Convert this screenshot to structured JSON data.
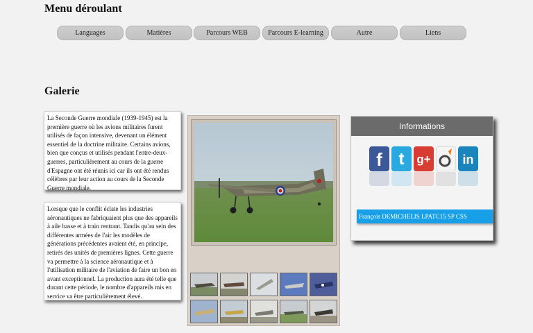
{
  "headings": {
    "menu_title": "Menu déroulant",
    "gallery_title": "Galerie"
  },
  "menu": {
    "items": [
      {
        "label": "Languages"
      },
      {
        "label": "Matières"
      },
      {
        "label": "Parcours WEB"
      },
      {
        "label": "Parcours E-learning"
      },
      {
        "label": "Autre"
      },
      {
        "label": "Liens"
      }
    ]
  },
  "articles": [
    {
      "text": "La Seconde Guerre mondiale (1939-1945) est la première guerre où les avions militaires furent utilisés de façon intensive, devenant un élément essentiel de la doctrine militaire. Certains avions, bien que conçus et utilisés pendant l'entre-deux-guerres, particulièrement au cours de la guerre d'Espagne ont été réunis ici car ils ont été rendus célèbres par leur action au cours de la Seconde Guerre mondiale."
    },
    {
      "text": "Lorsque que le conflit éclate les industries aéronautiques ne fabriquaient plus que des appareils à aile basse et à train rentrant. Tandis qu'au sein des différentes armées de l'air les modèles de générations précédentes avaient été, en principe, retirés des unités de premières lignes. Cette guerre va permettre à la science aéronautique et à l'utilisation militaire de l'aviation de faire un bon en avant exceptionnel. La production aura été telle que durant cette période, le nombre d'appareils mis en service va être particulièrement élevé."
    }
  ],
  "gallery": {
    "main_photo": "spitfire-photo",
    "thumbnails": [
      {
        "name": "thumb-plane-1"
      },
      {
        "name": "thumb-plane-2"
      },
      {
        "name": "thumb-plane-3"
      },
      {
        "name": "thumb-plane-4"
      },
      {
        "name": "thumb-plane-5"
      },
      {
        "name": "thumb-plane-6"
      },
      {
        "name": "thumb-plane-7"
      },
      {
        "name": "thumb-plane-8"
      },
      {
        "name": "thumb-plane-9"
      },
      {
        "name": "thumb-plane-10"
      }
    ]
  },
  "info_panel": {
    "title": "Informations",
    "social": [
      {
        "icon": "facebook-icon",
        "glyph": "f",
        "color": "#3b5998"
      },
      {
        "icon": "twitter-icon",
        "glyph": "t",
        "color": "#2aa9e0"
      },
      {
        "icon": "google-plus-icon",
        "glyph": "g+",
        "color": "#d73d32"
      },
      {
        "icon": "viadeo-icon",
        "glyph": "v",
        "color": "#f4f4f4"
      },
      {
        "icon": "linkedin-icon",
        "glyph": "in",
        "color": "#1a84bc"
      }
    ],
    "author": "François DEMICHELIS LPATC15 SP CSS"
  }
}
